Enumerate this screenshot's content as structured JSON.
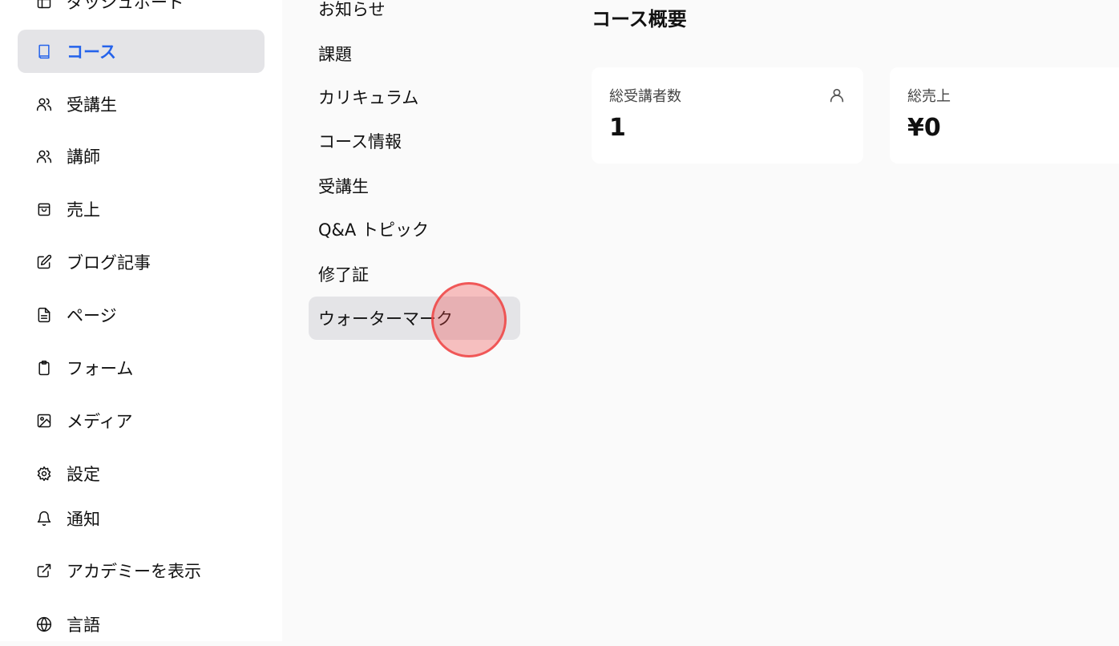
{
  "sidebar": {
    "items": [
      {
        "label": "ダッシュボード",
        "icon": "dashboard-icon",
        "active": false
      },
      {
        "label": "コース",
        "icon": "book-icon",
        "active": true
      },
      {
        "label": "受講生",
        "icon": "users-icon",
        "active": false
      },
      {
        "label": "講師",
        "icon": "users-icon",
        "active": false
      },
      {
        "label": "売上",
        "icon": "shopping-bag-icon",
        "active": false
      },
      {
        "label": "ブログ記事",
        "icon": "edit-icon",
        "active": false
      },
      {
        "label": "ページ",
        "icon": "file-text-icon",
        "active": false
      },
      {
        "label": "フォーム",
        "icon": "clipboard-icon",
        "active": false
      },
      {
        "label": "メディア",
        "icon": "image-icon",
        "active": false
      },
      {
        "label": "設定",
        "icon": "gear-icon",
        "active": false
      },
      {
        "label": "通知",
        "icon": "bell-icon",
        "active": false
      },
      {
        "label": "アカデミーを表示",
        "icon": "external-link-icon",
        "active": false
      },
      {
        "label": "言語",
        "icon": "globe-icon",
        "active": false
      }
    ]
  },
  "submenu": {
    "items": [
      {
        "label": "お知らせ",
        "active": false
      },
      {
        "label": "課題",
        "active": false
      },
      {
        "label": "カリキュラム",
        "active": false
      },
      {
        "label": "コース情報",
        "active": false
      },
      {
        "label": "受講生",
        "active": false
      },
      {
        "label": "Q&A トピック",
        "active": false
      },
      {
        "label": "修了証",
        "active": false
      },
      {
        "label": "ウォーターマーク",
        "active": true
      }
    ]
  },
  "main": {
    "title": "コース概要",
    "stats": [
      {
        "label": "総受講者数",
        "value": "1",
        "icon": "user-icon"
      },
      {
        "label": "総売上",
        "value": "¥0"
      }
    ]
  },
  "colors": {
    "accent": "#2563eb",
    "active_bg": "#e4e4e7",
    "click_indicator": "#ef4444"
  }
}
